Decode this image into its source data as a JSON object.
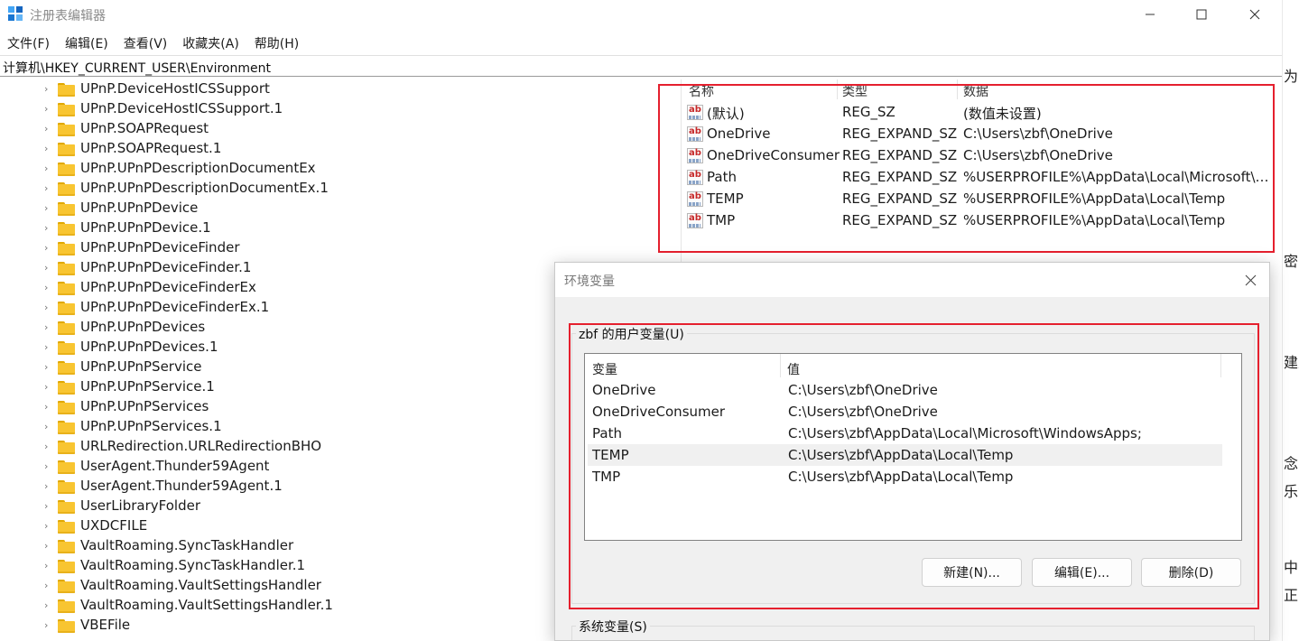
{
  "window": {
    "title": "注册表编辑器",
    "menu": [
      "文件(F)",
      "编辑(E)",
      "查看(V)",
      "收藏夹(A)",
      "帮助(H)"
    ],
    "address": "计算机\\HKEY_CURRENT_USER\\Environment"
  },
  "tree": {
    "items": [
      "UPnP.DeviceHostICSSupport",
      "UPnP.DeviceHostICSSupport.1",
      "UPnP.SOAPRequest",
      "UPnP.SOAPRequest.1",
      "UPnP.UPnPDescriptionDocumentEx",
      "UPnP.UPnPDescriptionDocumentEx.1",
      "UPnP.UPnPDevice",
      "UPnP.UPnPDevice.1",
      "UPnP.UPnPDeviceFinder",
      "UPnP.UPnPDeviceFinder.1",
      "UPnP.UPnPDeviceFinderEx",
      "UPnP.UPnPDeviceFinderEx.1",
      "UPnP.UPnPDevices",
      "UPnP.UPnPDevices.1",
      "UPnP.UPnPService",
      "UPnP.UPnPService.1",
      "UPnP.UPnPServices",
      "UPnP.UPnPServices.1",
      "URLRedirection.URLRedirectionBHO",
      "UserAgent.Thunder59Agent",
      "UserAgent.Thunder59Agent.1",
      "UserLibraryFolder",
      "UXDCFILE",
      "VaultRoaming.SyncTaskHandler",
      "VaultRoaming.SyncTaskHandler.1",
      "VaultRoaming.VaultSettingsHandler",
      "VaultRoaming.VaultSettingsHandler.1",
      "VBEFile"
    ]
  },
  "values": {
    "headers": [
      "名称",
      "类型",
      "数据"
    ],
    "rows": [
      {
        "name": "(默认)",
        "type": "REG_SZ",
        "data": "(数值未设置)"
      },
      {
        "name": "OneDrive",
        "type": "REG_EXPAND_SZ",
        "data": "C:\\Users\\zbf\\OneDrive"
      },
      {
        "name": "OneDriveConsumer",
        "type": "REG_EXPAND_SZ",
        "data": "C:\\Users\\zbf\\OneDrive"
      },
      {
        "name": "Path",
        "type": "REG_EXPAND_SZ",
        "data": "%USERPROFILE%\\AppData\\Local\\Microsoft\\WindowsApps;"
      },
      {
        "name": "TEMP",
        "type": "REG_EXPAND_SZ",
        "data": "%USERPROFILE%\\AppData\\Local\\Temp"
      },
      {
        "name": "TMP",
        "type": "REG_EXPAND_SZ",
        "data": "%USERPROFILE%\\AppData\\Local\\Temp"
      }
    ]
  },
  "dialog": {
    "title": "环境变量",
    "user_group_label": "zbf 的用户变量(U)",
    "columns": [
      "变量",
      "值"
    ],
    "rows": [
      {
        "key": "OneDrive",
        "value": "C:\\Users\\zbf\\OneDrive"
      },
      {
        "key": "OneDriveConsumer",
        "value": "C:\\Users\\zbf\\OneDrive"
      },
      {
        "key": "Path",
        "value": "C:\\Users\\zbf\\AppData\\Local\\Microsoft\\WindowsApps;"
      },
      {
        "key": "TEMP",
        "value": "C:\\Users\\zbf\\AppData\\Local\\Temp"
      },
      {
        "key": "TMP",
        "value": "C:\\Users\\zbf\\AppData\\Local\\Temp"
      }
    ],
    "selected_row": "TEMP",
    "buttons": {
      "new": "新建(N)...",
      "edit": "编辑(E)...",
      "delete": "删除(D)"
    },
    "system_group_label": "系统变量(S)"
  },
  "background_fragments": [
    "为囗",
    "密",
    "建生",
    "念",
    "乐贡",
    "中",
    "正"
  ],
  "colors": {
    "highlight_border": "#e5202e",
    "folder": "#f8c531"
  }
}
